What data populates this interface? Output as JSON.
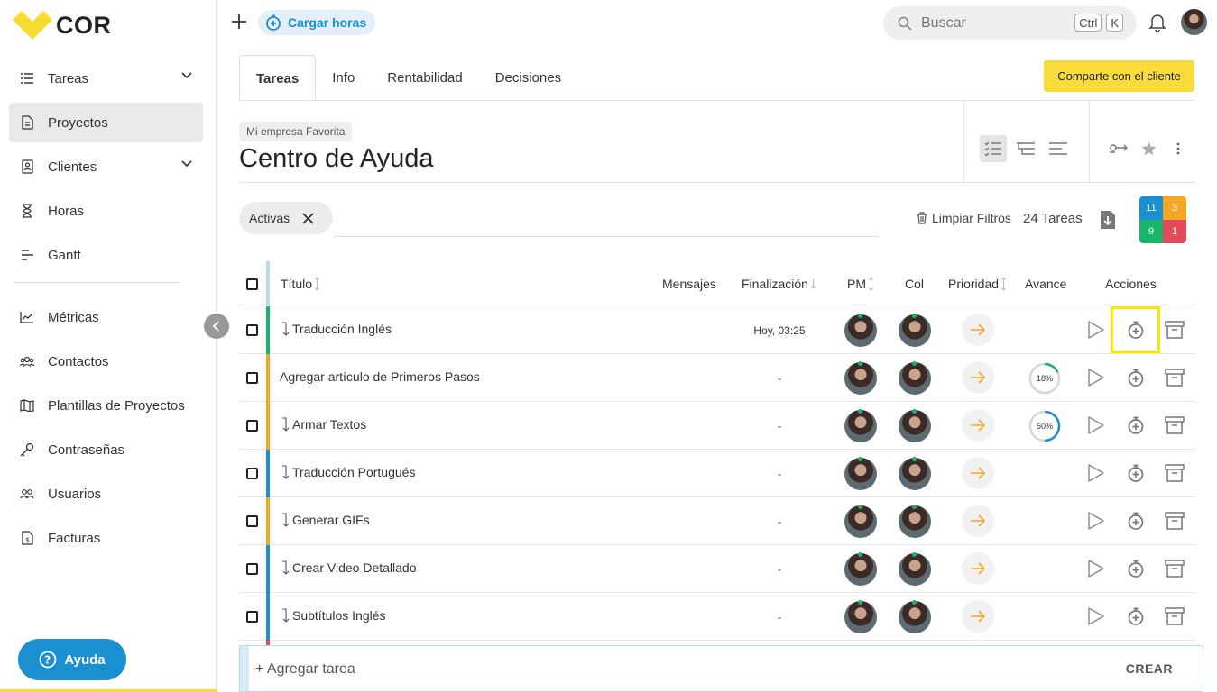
{
  "brand": {
    "name": "COR",
    "accent": "#f6dc2e",
    "help_color": "#1a8fd1"
  },
  "sidebar": {
    "items": [
      {
        "label": "Tareas",
        "icon": "task-list-icon",
        "expandable": true
      },
      {
        "label": "Proyectos",
        "icon": "project-file-icon",
        "active": true
      },
      {
        "label": "Clientes",
        "icon": "client-card-icon",
        "expandable": true
      },
      {
        "label": "Horas",
        "icon": "hourglass-icon"
      },
      {
        "label": "Gantt",
        "icon": "gantt-icon"
      },
      {
        "label": "Métricas",
        "icon": "metrics-chart-icon"
      },
      {
        "label": "Contactos",
        "icon": "contacts-icon"
      },
      {
        "label": "Plantillas de Proyectos",
        "icon": "map-template-icon"
      },
      {
        "label": "Contraseñas",
        "icon": "key-icon"
      },
      {
        "label": "Usuarios",
        "icon": "users-icon"
      },
      {
        "label": "Facturas",
        "icon": "invoice-icon"
      }
    ],
    "help_label": "Ayuda"
  },
  "topbar": {
    "cargar_label": "Cargar horas",
    "search_placeholder": "Buscar",
    "shortcut_keys": [
      "Ctrl",
      "K"
    ]
  },
  "tabs": [
    "Tareas",
    "Info",
    "Rentabilidad",
    "Decisiones"
  ],
  "share_label": "Comparte con el cliente",
  "project": {
    "company": "Mi empresa Favorita",
    "title": "Centro de Ayuda"
  },
  "filters": {
    "chip_label": "Activas",
    "clear_label": "Limpiar Filtros",
    "tasks_count": "24 Tareas"
  },
  "status_counts": [
    {
      "value": "11",
      "color": "#1a8fd1"
    },
    {
      "value": "3",
      "color": "#f5a623"
    },
    {
      "value": "9",
      "color": "#19b46b"
    },
    {
      "value": "1",
      "color": "#e24a5a"
    }
  ],
  "table": {
    "headers": {
      "title": "Título",
      "messages": "Mensajes",
      "due": "Finalización",
      "pm": "PM",
      "col": "Col",
      "priority": "Prioridad",
      "progress": "Avance",
      "actions": "Acciones"
    },
    "rows": [
      {
        "title": "Traducción Inglés",
        "subtask": true,
        "due": "Hoy, 03:25",
        "bar": "#19b46b",
        "progress": null
      },
      {
        "title": "Agregar artículo de Primeros Pasos",
        "subtask": false,
        "due": "-",
        "bar": "#f5a623",
        "progress": 18,
        "progress_label": "18%"
      },
      {
        "title": "Armar Textos",
        "subtask": true,
        "due": "-",
        "bar": "#f5a623",
        "progress": 50,
        "progress_label": "50%"
      },
      {
        "title": "Traducción Portugués",
        "subtask": true,
        "due": "-",
        "bar": "#1a8fd1",
        "progress": null
      },
      {
        "title": "Generar GIFs",
        "subtask": true,
        "due": "-",
        "bar": "#f5a623",
        "progress": null
      },
      {
        "title": "Crear Video Detallado",
        "subtask": true,
        "due": "-",
        "bar": "#1a8fd1",
        "progress": null
      },
      {
        "title": "Subtítulos Inglés",
        "subtask": true,
        "due": "-",
        "bar": "#1a8fd1",
        "progress": null
      }
    ]
  },
  "add_task": {
    "placeholder": "+ Agregar tarea",
    "create_label": "CREAR"
  }
}
